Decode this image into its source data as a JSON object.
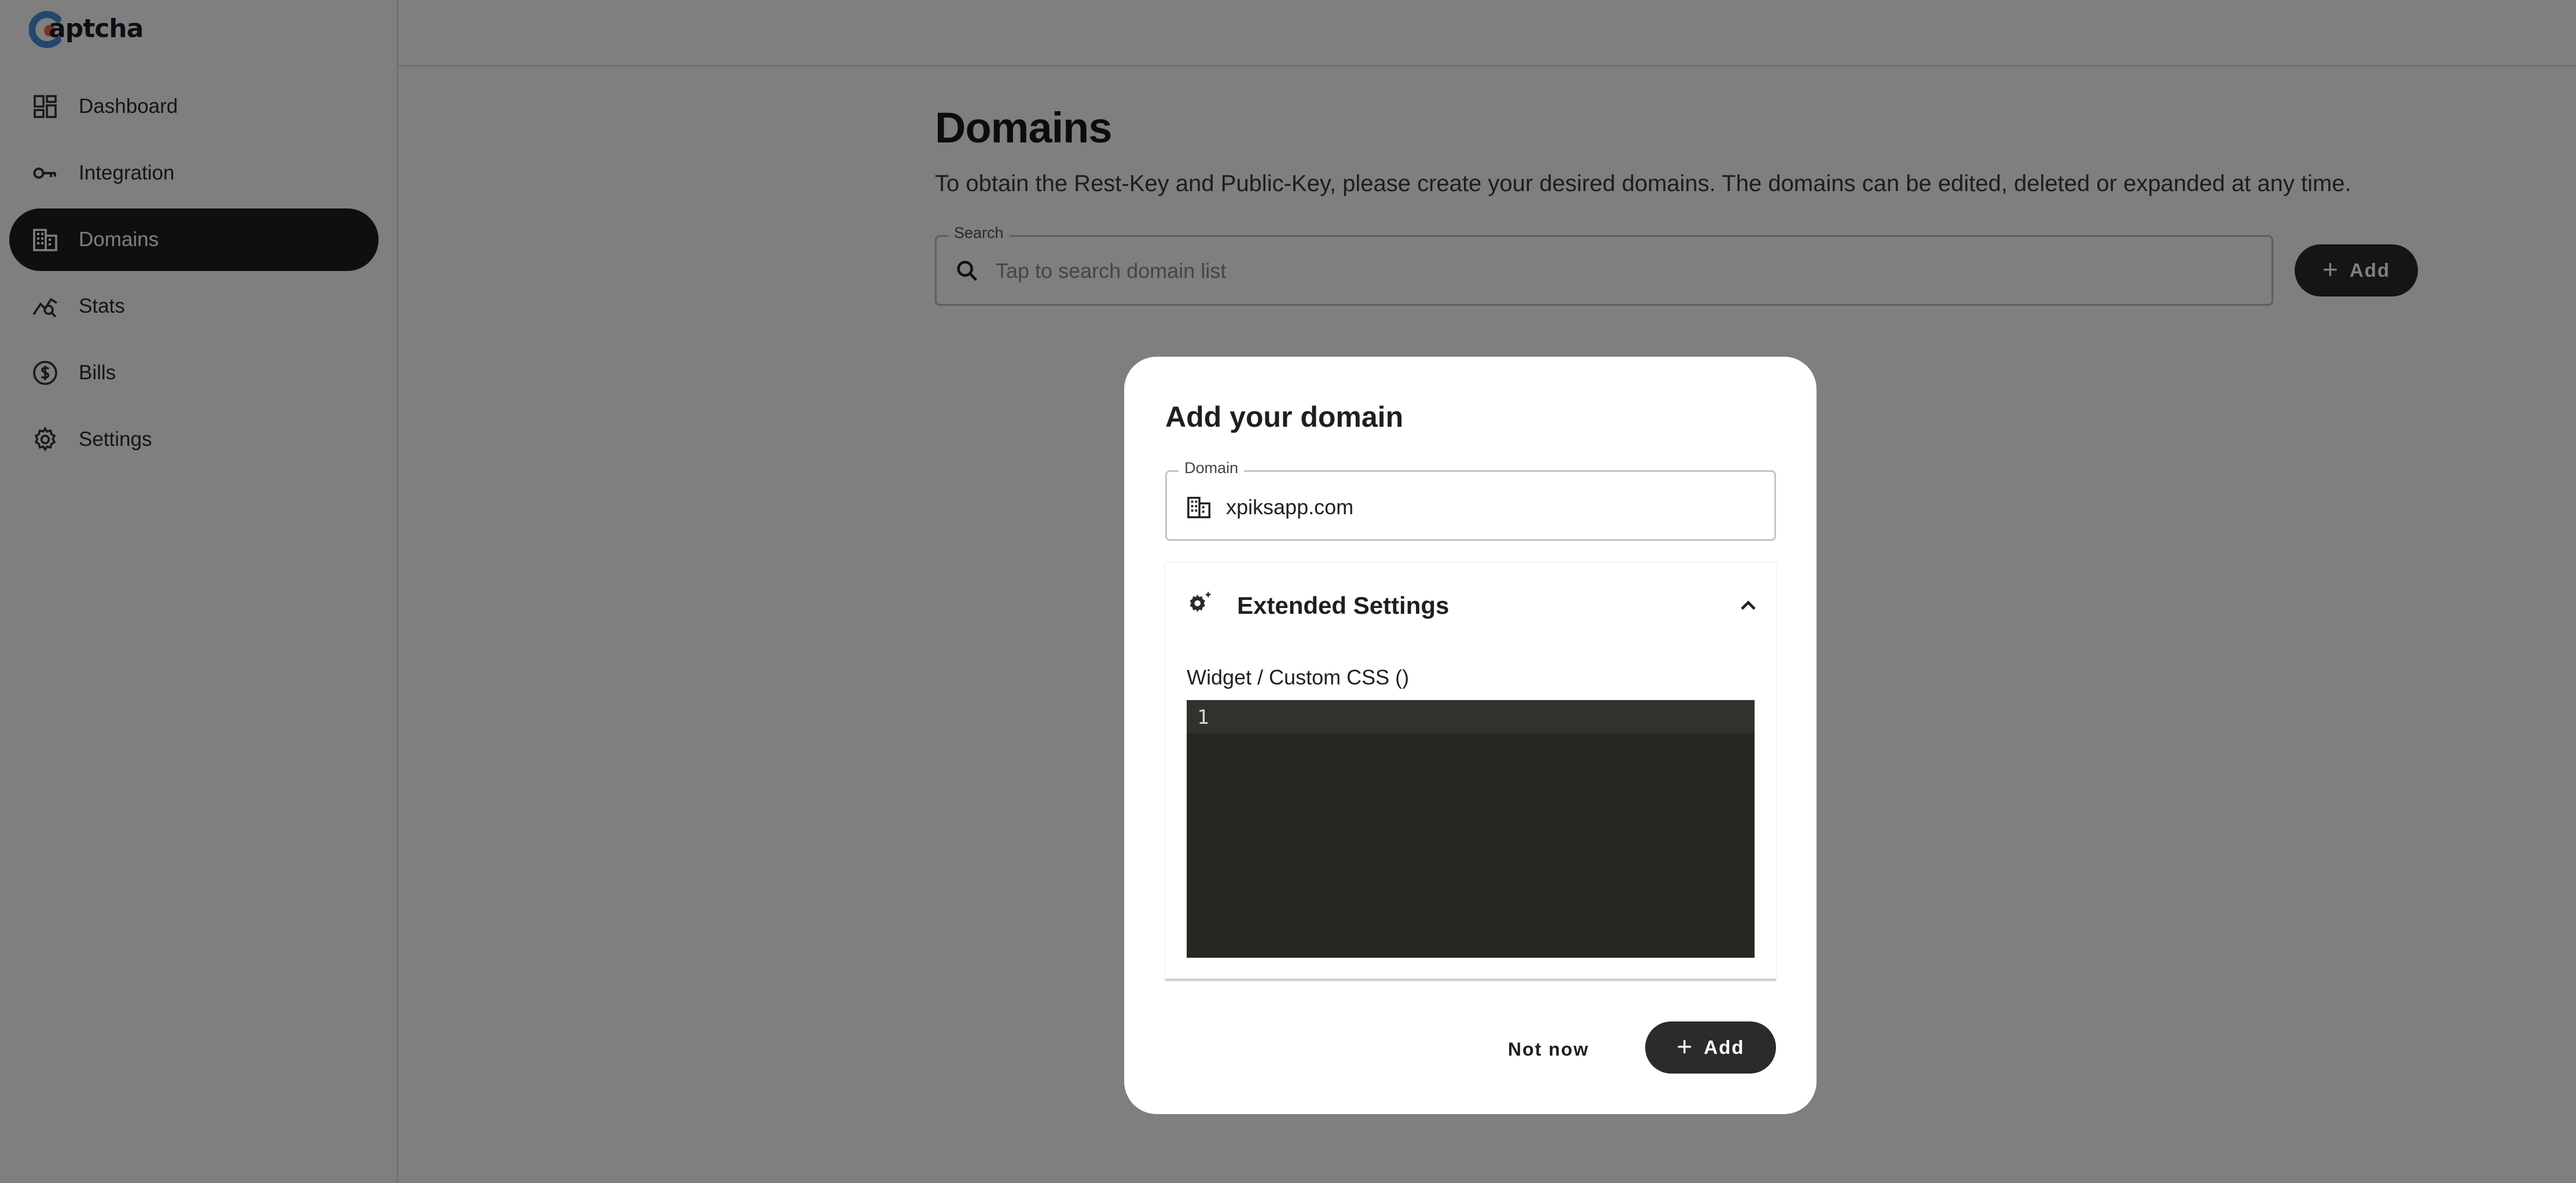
{
  "app": {
    "logo_text": "aptcha",
    "logo_letter": "C",
    "brand_colors": {
      "blue": "#4a8fd9",
      "orange": "#f26b3a"
    }
  },
  "sidebar": {
    "items": [
      {
        "label": "Dashboard",
        "icon": "dashboard-icon",
        "active": false
      },
      {
        "label": "Integration",
        "icon": "key-icon",
        "active": false
      },
      {
        "label": "Domains",
        "icon": "building-icon",
        "active": true
      },
      {
        "label": "Stats",
        "icon": "stats-icon",
        "active": false
      },
      {
        "label": "Bills",
        "icon": "dollar-icon",
        "active": false
      },
      {
        "label": "Settings",
        "icon": "gear-icon",
        "active": false
      }
    ]
  },
  "main": {
    "title": "Domains",
    "description": "To obtain the Rest-Key and Public-Key, please create your desired domains. The domains can be edited, deleted or expanded at any time.",
    "search": {
      "label": "Search",
      "placeholder": "Tap to search domain list",
      "value": ""
    },
    "add_label": "Add"
  },
  "dialog": {
    "title": "Add your domain",
    "domain_field": {
      "label": "Domain",
      "value": "xpiksapp.com"
    },
    "extended_settings": {
      "title": "Extended Settings",
      "expanded": true,
      "css_label": "Widget / Custom CSS ()",
      "line_number": "1"
    },
    "not_now_label": "Not now",
    "add_label": "Add"
  },
  "colors": {
    "overlay": "rgba(0,0,0,0.5)",
    "primary_button": "#2b2b2b",
    "editor_background": "#272822"
  }
}
